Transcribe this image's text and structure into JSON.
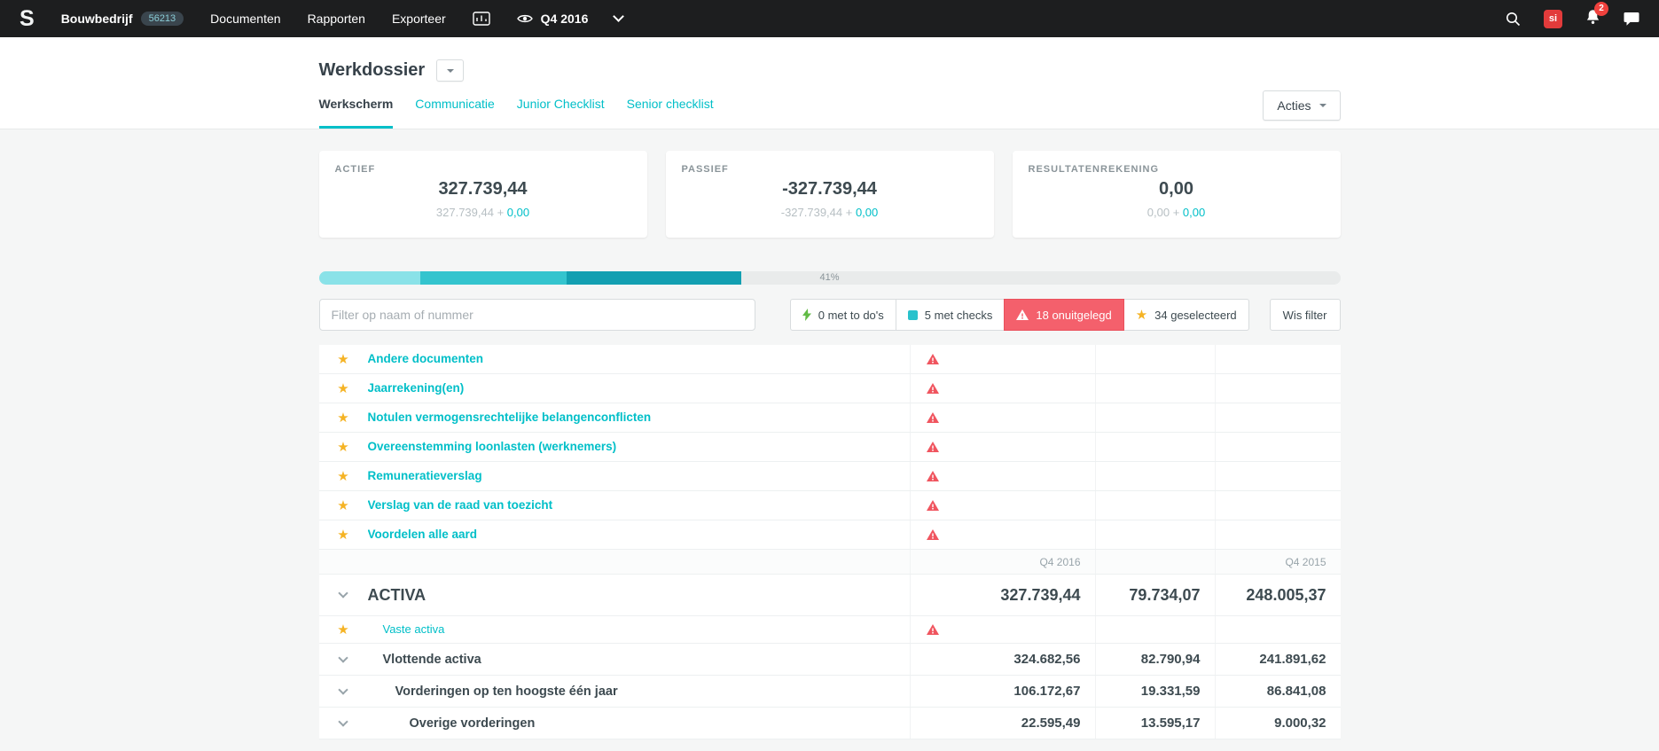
{
  "navbar": {
    "logo_letter": "S",
    "company": "Bouwbedrijf",
    "company_badge": "56213",
    "items": [
      "Documenten",
      "Rapporten",
      "Exporteer"
    ],
    "period": "Q4 2016",
    "sync_app_label": "si",
    "notification_count": "2"
  },
  "header": {
    "title": "Werkdossier",
    "tabs": [
      {
        "label": "Werkscherm"
      },
      {
        "label": "Communicatie"
      },
      {
        "label": "Junior Checklist"
      },
      {
        "label": "Senior checklist"
      }
    ],
    "actions_button": "Acties"
  },
  "cards": [
    {
      "title": "ACTIEF",
      "value": "327.739,44",
      "base": "327.739,44 + ",
      "delta": "0,00"
    },
    {
      "title": "PASSIEF",
      "value": "-327.739,44",
      "base": "-327.739,44 + ",
      "delta": "0,00"
    },
    {
      "title": "RESULTATENREKENING",
      "value": "0,00",
      "base": "0,00 + ",
      "delta": "0,00"
    }
  ],
  "progress": {
    "label": "41%",
    "segment_widths": [
      "9.9%",
      "14.4%",
      "17.1%"
    ],
    "segment_colors": [
      "#8ae2e8",
      "#34c4ce",
      "#129fb1"
    ]
  },
  "filter": {
    "placeholder": "Filter op naam of nummer",
    "buttons": [
      {
        "label": "0 met to do's"
      },
      {
        "label": "5 met checks"
      },
      {
        "label": "18 onuitgelegd"
      },
      {
        "label": "34 geselecteerd"
      }
    ],
    "clear_label": "Wis filter"
  },
  "documents": [
    {
      "name": "Andere documenten"
    },
    {
      "name": "Jaarrekening(en)"
    },
    {
      "name": "Notulen vermogensrechtelijke belangenconflicten"
    },
    {
      "name": "Overeenstemming loonlasten (werknemers)"
    },
    {
      "name": "Remuneratieverslag"
    },
    {
      "name": "Verslag van de raad van toezicht"
    },
    {
      "name": "Voordelen alle aard"
    }
  ],
  "statement": {
    "column_headers": {
      "col1": "Q4 2016",
      "col3": "Q4 2015"
    },
    "rows": [
      {
        "name": "ACTIVA",
        "values": [
          "327.739,44",
          "79.734,07",
          "248.005,37"
        ]
      },
      {
        "name": "Vaste activa",
        "values": [
          "",
          "",
          ""
        ]
      },
      {
        "name": "Vlottende activa",
        "values": [
          "324.682,56",
          "82.790,94",
          "241.891,62"
        ]
      },
      {
        "name": "Vorderingen op ten hoogste één jaar",
        "values": [
          "106.172,67",
          "19.331,59",
          "86.841,08"
        ]
      },
      {
        "name": "Overige vorderingen",
        "values": [
          "22.595,49",
          "13.595,17",
          "9.000,32"
        ]
      }
    ]
  },
  "theme": {
    "accent_teal": "#00bfc8",
    "warning_red": "#f0555f",
    "star_yellow": "#f5b324",
    "active_filter_bg": "#f4606c",
    "todo_green": "#62bb46",
    "navbar_bg": "#1d1e1f"
  }
}
